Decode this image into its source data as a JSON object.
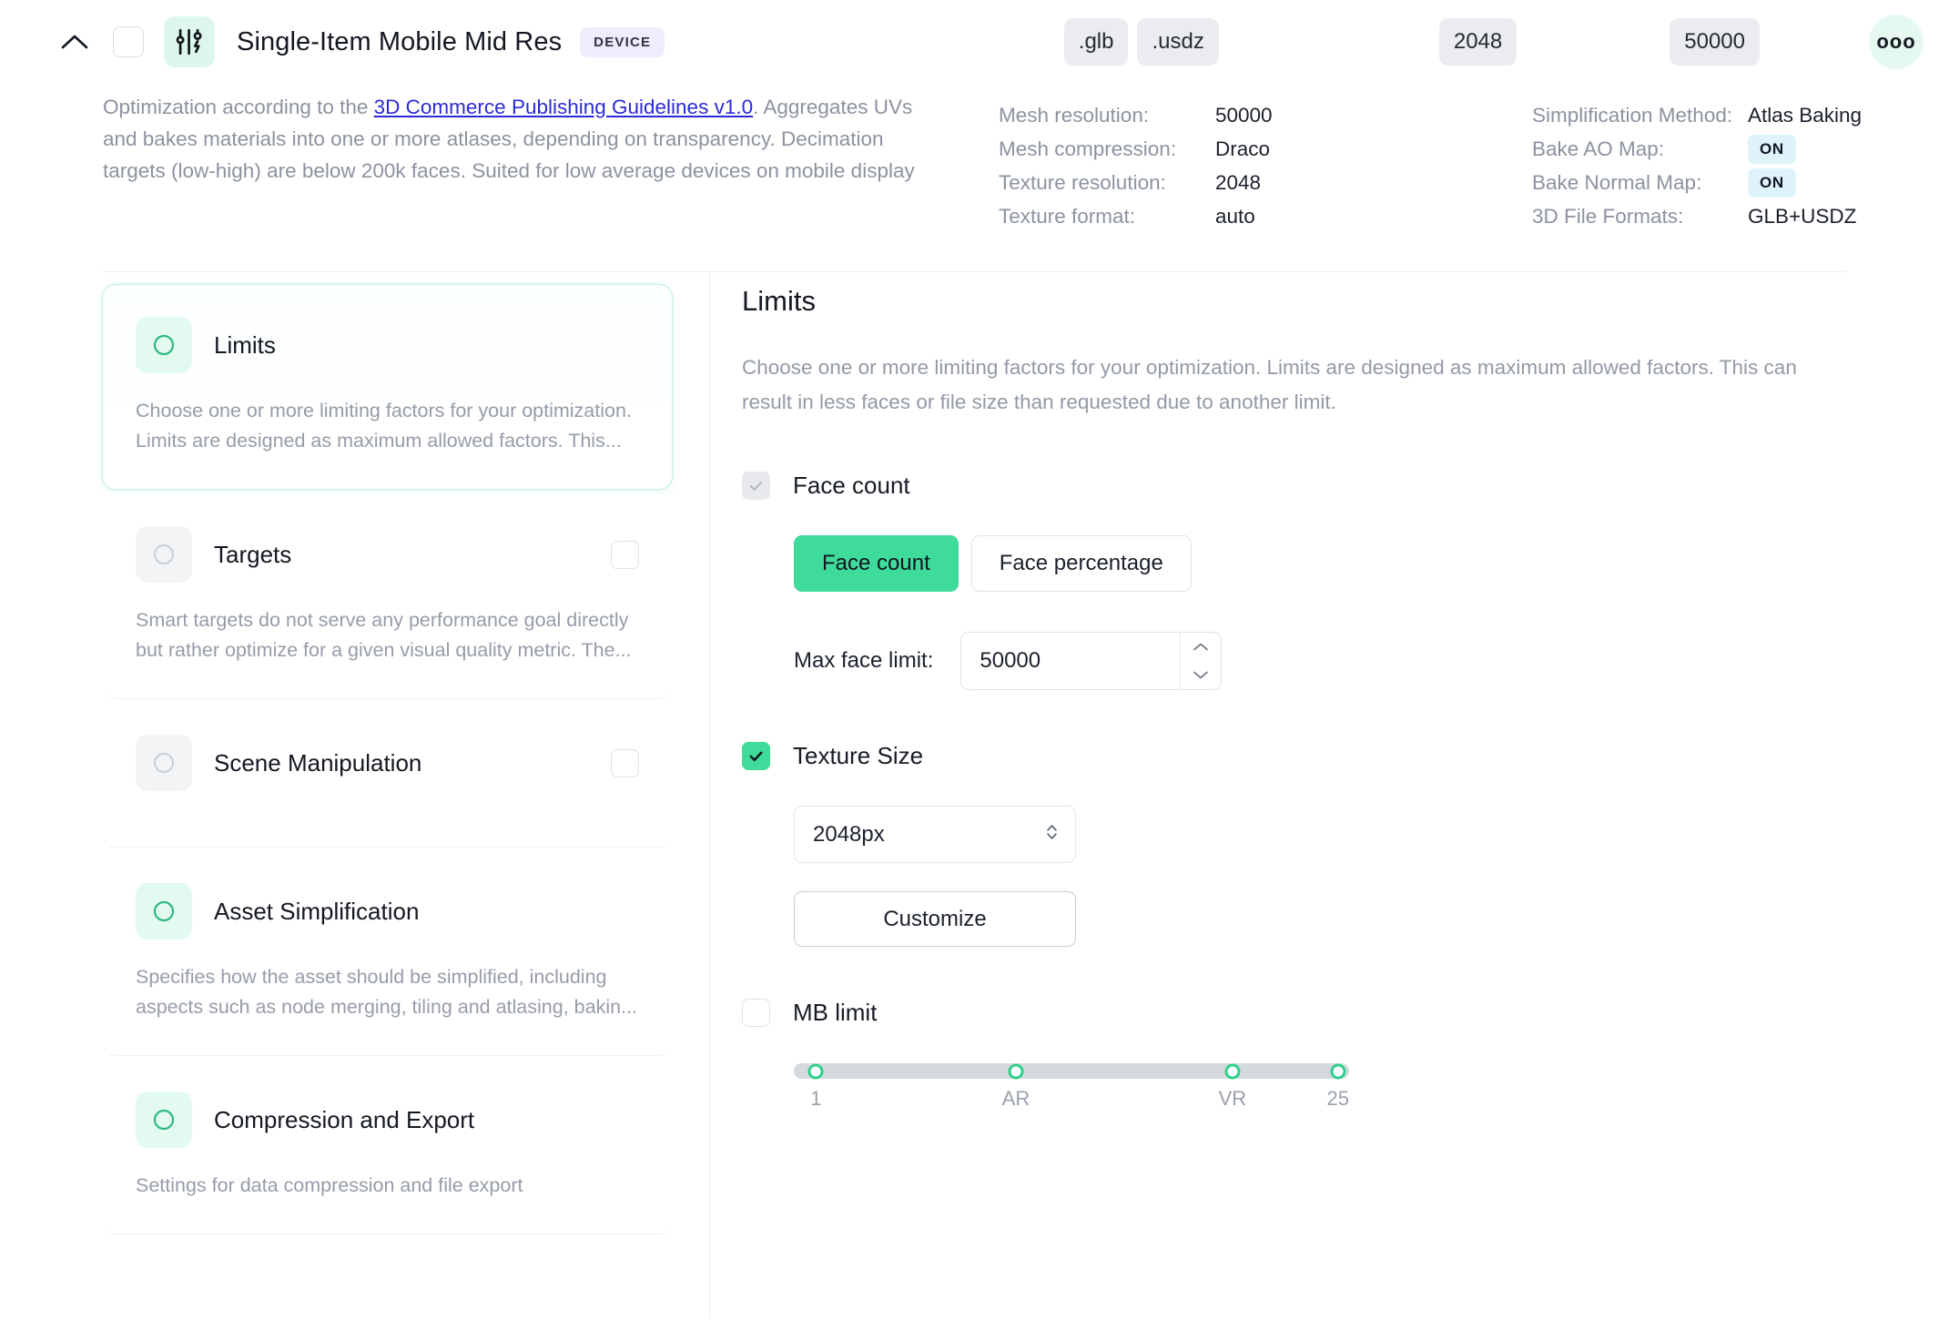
{
  "header": {
    "collapse_icon": "chevron-up-icon",
    "select_checkbox_checked": false,
    "preset_icon": "sliders-bolt-icon",
    "title": "Single-Item Mobile Mid Res",
    "badge": "DEVICE",
    "chips": [
      ".glb",
      ".usdz"
    ],
    "texture_chip": "2048",
    "faces_chip": "50000",
    "more_label": "ooo"
  },
  "summary": {
    "desc_before_link": "Optimization according to the ",
    "link_text": "3D Commerce Publishing Guidelines v1.0",
    "desc_after_link": ". Aggregates UVs and bakes materials into one or more atlases, depending on transparency. Decimation targets (low-high) are below 200k faces. Suited for low average devices on mobile display",
    "meta_left": [
      {
        "key": "Mesh resolution:",
        "value": "50000",
        "type": "text"
      },
      {
        "key": "Mesh compression:",
        "value": "Draco",
        "type": "text"
      },
      {
        "key": "Texture resolution:",
        "value": "2048",
        "type": "text"
      },
      {
        "key": "Texture format:",
        "value": "auto",
        "type": "text"
      }
    ],
    "meta_right": [
      {
        "key": "Simplification Method:",
        "value": "Atlas Baking",
        "type": "text"
      },
      {
        "key": "Bake AO Map:",
        "value": "ON",
        "type": "pill"
      },
      {
        "key": "Bake Normal Map:",
        "value": "ON",
        "type": "pill"
      },
      {
        "key": "3D File Formats:",
        "value": "GLB+USDZ",
        "type": "text"
      }
    ]
  },
  "sidebar": {
    "cards": [
      {
        "title": "Limits",
        "desc": "Choose one or more limiting factors for your optimization. Limits are designed as maximum allowed factors. This...",
        "active": true,
        "icon_on": true,
        "has_checkbox": false
      },
      {
        "title": "Targets",
        "desc": "Smart targets do not serve any performance goal directly but rather optimize for a given visual quality metric. The...",
        "active": false,
        "icon_on": false,
        "has_checkbox": true
      },
      {
        "title": "Scene Manipulation",
        "desc": "",
        "active": false,
        "icon_on": false,
        "has_checkbox": true
      },
      {
        "title": "Asset Simplification",
        "desc": "Specifies how the asset should be simplified, including aspects such as node merging, tiling and atlasing, bakin...",
        "active": false,
        "icon_on": true,
        "has_checkbox": false
      },
      {
        "title": "Compression and Export",
        "desc": "Settings for data compression and file export",
        "active": false,
        "icon_on": true,
        "has_checkbox": false
      }
    ]
  },
  "panel": {
    "title": "Limits",
    "description": "Choose one or more limiting factors for your optimization. Limits are designed as maximum allowed factors. This can result in less faces or file size than requested due to another limit.",
    "face_count": {
      "label": "Face count",
      "checked": true,
      "checkbox_state": "checked-grey",
      "segments": [
        {
          "label": "Face count",
          "selected": true
        },
        {
          "label": "Face percentage",
          "selected": false
        }
      ],
      "field_label": "Max face limit:",
      "field_value": "50000"
    },
    "texture_size": {
      "label": "Texture Size",
      "checked": true,
      "checkbox_state": "checked-green",
      "select_value": "2048px",
      "customize_label": "Customize"
    },
    "mb_limit": {
      "label": "MB limit",
      "checked": false,
      "checkbox_state": "empty",
      "slider": {
        "min": 1,
        "max": 25,
        "markers": [
          {
            "label": "1",
            "pos_pct": 4
          },
          {
            "label": "AR",
            "pos_pct": 40
          },
          {
            "label": "VR",
            "pos_pct": 79
          },
          {
            "label": "25",
            "pos_pct": 98
          }
        ]
      }
    }
  },
  "colors": {
    "accent_green": "#3fdb9b",
    "ring_green": "#2fd18c",
    "tile_green": "#e3faf0",
    "link_blue": "#2b2bd6",
    "badge_purple": "#f1ecfb",
    "pill_blue": "#def4fa"
  }
}
